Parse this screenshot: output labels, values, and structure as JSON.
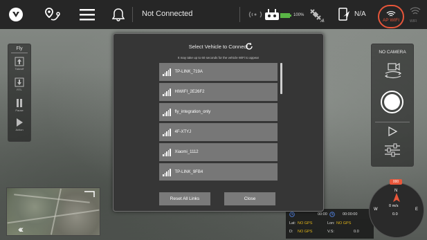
{
  "topbar": {
    "connection_status": "Not Connected",
    "battery_text": "100%",
    "gps_text": "N/A",
    "ap_wifi_label": "AP WIFI",
    "wifi_label": "WIFI"
  },
  "fly_panel": {
    "title": "Fly",
    "buttons": [
      {
        "label": "Takeoff",
        "icon": "takeoff-icon"
      },
      {
        "label": "RTL",
        "icon": "rtl-icon"
      },
      {
        "label": "Pause",
        "icon": "pause-icon"
      },
      {
        "label": "Action",
        "icon": "play-icon"
      }
    ]
  },
  "dialog": {
    "title": "Select Vehicle to Connect",
    "subtitle": "It may take up to 60 seconds for the vehicle WiFi to appear",
    "networks": [
      "TP-LINK_719A",
      "HIWIFI_2E26F2",
      "fly_integration_only",
      "4F-XTYJ",
      "Xiaomi_1112",
      "TP-LINK_9FB4"
    ],
    "reset_label": "Reset All Links",
    "close_label": "Close"
  },
  "camera_panel": {
    "title": "NO CAMERA"
  },
  "telemetry": {
    "time1": "00:00",
    "time2": "00:00:00",
    "lat_label": "Lat:",
    "lat_value": "NO GPS",
    "lon_label": "Lon:",
    "lon_value": "NO GPS",
    "d_label": "D:",
    "d_value": "NO GPS",
    "vs_label": "V.S:",
    "vs_value": "0.0"
  },
  "compass": {
    "heading": "000",
    "n": "N",
    "w": "W",
    "e": "E",
    "speed_label": "0 m/s",
    "alt": "0.0"
  },
  "colors": {
    "accent": "#e8563a",
    "gps_yellow": "#e0b418"
  }
}
